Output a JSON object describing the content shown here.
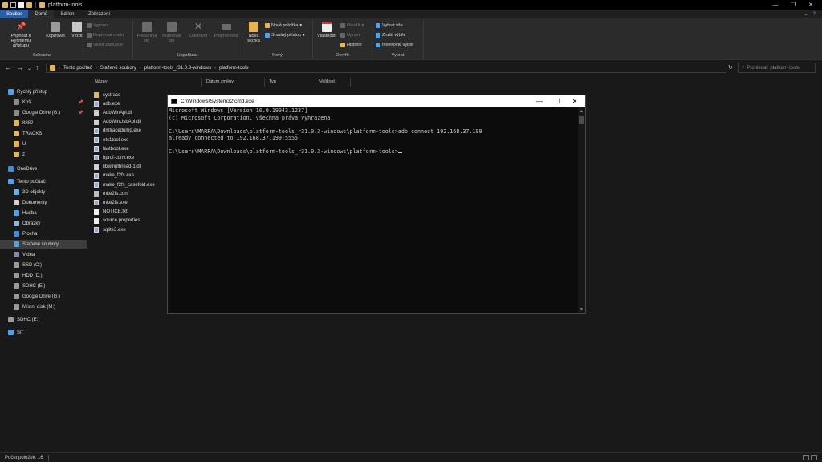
{
  "titlebar": {
    "title": "platform-tools",
    "minimize": "—",
    "maximize": "❐",
    "close": "✕"
  },
  "ribbon": {
    "tabs": {
      "file": "Soubor",
      "home": "Domů",
      "share": "Sdílení",
      "view": "Zobrazení"
    },
    "clipboard": {
      "label": "Schránka",
      "pin": "Připnout k Rychlému přístupu",
      "copy": "Kopírovat",
      "paste": "Vložit",
      "cut": "Vyjmout",
      "copy_path": "Kopírovat cestu",
      "paste_shortcut": "Vložit zástupce"
    },
    "organize": {
      "label": "Uspořádat",
      "move_to": "Přesunout do",
      "copy_to": "Kopírovat do",
      "delete": "Odstranit",
      "rename": "Přejmenovat"
    },
    "new": {
      "label": "Nový",
      "new_folder": "Nová složka",
      "new_item": "Nová položka",
      "easy_access": "Snadný přístup"
    },
    "open": {
      "label": "Otevřít",
      "properties": "Vlastnosti",
      "open": "Otevřít",
      "edit": "Upravit",
      "history": "Historie"
    },
    "select": {
      "label": "Vybrat",
      "select_all": "Vybrat vše",
      "select_none": "Zrušit výběr",
      "invert": "Invertovat výběr"
    }
  },
  "address": {
    "crumbs": [
      "Tento počítač",
      "Stažené soubory",
      "platform-tools_r31.0.3-windows",
      "platform-tools"
    ],
    "search_placeholder": "Prohledat: platform-tools"
  },
  "nav": {
    "items": [
      {
        "label": "Rychlý přístup",
        "icon": "star-icon",
        "color": "#4aa3f0",
        "indent": 0,
        "pinned": false
      },
      {
        "label": "Koš",
        "icon": "recycle-bin-icon",
        "color": "#8a8a8a",
        "indent": 1,
        "pinned": true
      },
      {
        "label": "Google Drive (G:)",
        "icon": "drive-icon",
        "color": "#8a8a8a",
        "indent": 1,
        "pinned": true
      },
      {
        "label": "8882",
        "icon": "folder-icon",
        "color": "#e8b54a",
        "indent": 1,
        "pinned": false
      },
      {
        "label": "TRACKS",
        "icon": "folder-icon",
        "color": "#e8b54a",
        "indent": 1,
        "pinned": false
      },
      {
        "label": "U",
        "icon": "folder-icon",
        "color": "#e8b54a",
        "indent": 1,
        "pinned": false
      },
      {
        "label": "z",
        "icon": "folder-icon",
        "color": "#e8b54a",
        "indent": 1,
        "pinned": false
      },
      {
        "label": "OneDrive",
        "icon": "cloud-icon",
        "color": "#3c8fe0",
        "indent": 0,
        "pinned": false
      },
      {
        "label": "Tento počítač",
        "icon": "computer-icon",
        "color": "#4aa3f0",
        "indent": 0,
        "pinned": false
      },
      {
        "label": "3D objekty",
        "icon": "cube-icon",
        "color": "#5cb3f0",
        "indent": 1,
        "pinned": false
      },
      {
        "label": "Dokumenty",
        "icon": "documents-icon",
        "color": "#cfcfcf",
        "indent": 1,
        "pinned": false
      },
      {
        "label": "Hudba",
        "icon": "music-icon",
        "color": "#4aa3f0",
        "indent": 1,
        "pinned": false
      },
      {
        "label": "Obrázky",
        "icon": "pictures-icon",
        "color": "#8ab8d8",
        "indent": 1,
        "pinned": false
      },
      {
        "label": "Plocha",
        "icon": "desktop-icon",
        "color": "#3c8fe0",
        "indent": 1,
        "pinned": false
      },
      {
        "label": "Stažené soubory",
        "icon": "download-icon",
        "color": "#4aa3f0",
        "indent": 1,
        "pinned": false,
        "selected": true
      },
      {
        "label": "Videa",
        "icon": "video-icon",
        "color": "#8a8aa8",
        "indent": 1,
        "pinned": false
      },
      {
        "label": "SSD (C:)",
        "icon": "drive-icon",
        "color": "#9a9a9a",
        "indent": 1,
        "pinned": false
      },
      {
        "label": "HDD (D:)",
        "icon": "drive-icon",
        "color": "#9a9a9a",
        "indent": 1,
        "pinned": false
      },
      {
        "label": "SDHC (E:)",
        "icon": "drive-icon",
        "color": "#9a9a9a",
        "indent": 1,
        "pinned": false
      },
      {
        "label": "Google Drive (G:)",
        "icon": "drive-icon",
        "color": "#9a9a9a",
        "indent": 1,
        "pinned": false
      },
      {
        "label": "Místní disk (M:)",
        "icon": "drive-icon",
        "color": "#9a9a9a",
        "indent": 1,
        "pinned": false
      },
      {
        "label": "SDHC (E:)",
        "icon": "drive-icon",
        "color": "#9a9a9a",
        "indent": 0,
        "pinned": false
      },
      {
        "label": "Síť",
        "icon": "network-icon",
        "color": "#4aa3f0",
        "indent": 0,
        "pinned": false
      }
    ]
  },
  "files": {
    "columns": {
      "name": "Název",
      "date": "Datum změny",
      "type": "Typ",
      "size": "Velikost"
    },
    "rows": [
      {
        "name": "systrace",
        "kind": "folder"
      },
      {
        "name": "adb.exe",
        "kind": "exe"
      },
      {
        "name": "AdbWinApi.dll",
        "kind": "dll"
      },
      {
        "name": "AdbWinUsbApi.dll",
        "kind": "dll"
      },
      {
        "name": "dmtracedump.exe",
        "kind": "exe"
      },
      {
        "name": "etc1tool.exe",
        "kind": "exe"
      },
      {
        "name": "fastboot.exe",
        "kind": "exe"
      },
      {
        "name": "hprof-conv.exe",
        "kind": "exe"
      },
      {
        "name": "libwinpthread-1.dll",
        "kind": "dll"
      },
      {
        "name": "make_f2fs.exe",
        "kind": "exe"
      },
      {
        "name": "make_f2fs_casefold.exe",
        "kind": "exe"
      },
      {
        "name": "mke2fs.conf",
        "kind": "conf"
      },
      {
        "name": "mke2fs.exe",
        "kind": "exe"
      },
      {
        "name": "NOTICE.txt",
        "kind": "txt"
      },
      {
        "name": "source.properties",
        "kind": "txt"
      },
      {
        "name": "sqlite3.exe",
        "kind": "exe"
      }
    ]
  },
  "statusbar": {
    "item_count": "Počet položek: 16"
  },
  "cmd": {
    "title": "C:\\Windows\\System32\\cmd.exe",
    "lines": [
      "Microsoft Windows [Version 10.0.19043.1237]",
      "(c) Microsoft Corporation. Všechna práva vyhrazena.",
      "",
      "C:\\Users\\MARRA\\Downloads\\platform-tools_r31.0.3-windows\\platform-tools>adb connect 192.168.37.199",
      "already connected to 192.168.37.199:5555",
      "",
      "C:\\Users\\MARRA\\Downloads\\platform-tools_r31.0.3-windows\\platform-tools>"
    ]
  }
}
